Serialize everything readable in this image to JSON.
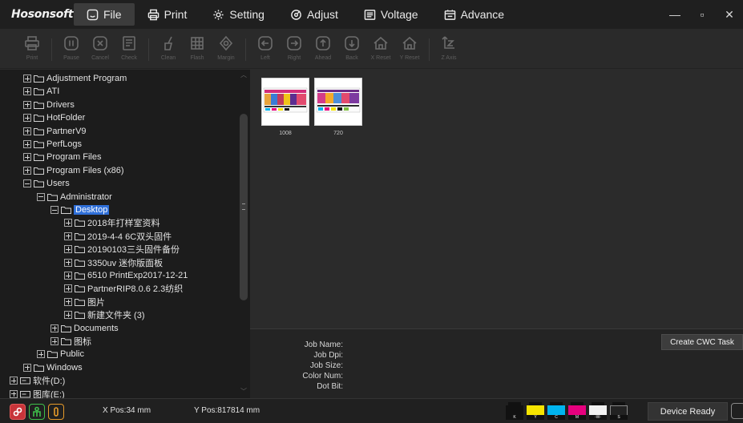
{
  "app": {
    "logo": "Hosonsoft"
  },
  "menu": [
    {
      "label": "File",
      "icon": "smile-icon"
    },
    {
      "label": "Print",
      "icon": "printer-icon"
    },
    {
      "label": "Setting",
      "icon": "gear-icon"
    },
    {
      "label": "Adjust",
      "icon": "adjust-icon"
    },
    {
      "label": "Voltage",
      "icon": "voltage-icon"
    },
    {
      "label": "Advance",
      "icon": "advance-icon"
    }
  ],
  "window": {
    "minimize": "—",
    "maximize": "▫",
    "close": "✕"
  },
  "toolbar": [
    {
      "label": "Print",
      "icon": "print-icon"
    },
    {
      "label": "Pause",
      "icon": "pause-icon"
    },
    {
      "label": "Cancel",
      "icon": "cancel-icon"
    },
    {
      "label": "Check",
      "icon": "check-icon"
    },
    {
      "label": "Clean",
      "icon": "clean-icon"
    },
    {
      "label": "Flash",
      "icon": "flash-icon"
    },
    {
      "label": "Margin",
      "icon": "margin-icon"
    },
    {
      "label": "Left",
      "icon": "left-icon"
    },
    {
      "label": "Right",
      "icon": "right-icon"
    },
    {
      "label": "Ahead",
      "icon": "ahead-icon"
    },
    {
      "label": "Back",
      "icon": "back-icon"
    },
    {
      "label": "X Reset",
      "icon": "x-reset-icon"
    },
    {
      "label": "Y Reset",
      "icon": "y-reset-icon"
    },
    {
      "label": "Z Axis",
      "icon": "z-axis-icon"
    }
  ],
  "tree": [
    {
      "label": "Adjustment Program",
      "level": 3,
      "expanded": false
    },
    {
      "label": "ATI",
      "level": 3,
      "expanded": false
    },
    {
      "label": "Drivers",
      "level": 3,
      "expanded": false
    },
    {
      "label": "HotFolder",
      "level": 3,
      "expanded": false
    },
    {
      "label": "PartnerV9",
      "level": 3,
      "expanded": false
    },
    {
      "label": "PerfLogs",
      "level": 3,
      "expanded": false
    },
    {
      "label": "Program Files",
      "level": 3,
      "expanded": false
    },
    {
      "label": "Program Files (x86)",
      "level": 3,
      "expanded": false
    },
    {
      "label": "Users",
      "level": 3,
      "expanded": true
    },
    {
      "label": "Administrator",
      "level": 4,
      "expanded": true
    },
    {
      "label": "Desktop",
      "level": 5,
      "expanded": true,
      "selected": true
    },
    {
      "label": "2018年打样室资料",
      "level": 6,
      "expanded": false
    },
    {
      "label": "2019-4-4 6C双头固件",
      "level": 6,
      "expanded": false
    },
    {
      "label": "20190103三头固件备份",
      "level": 6,
      "expanded": false
    },
    {
      "label": "3350uv 迷你版面板",
      "level": 6,
      "expanded": false
    },
    {
      "label": "6510 PrintExp2017-12-21",
      "level": 6,
      "expanded": false
    },
    {
      "label": "PartnerRIP8.0.6 2.3纺织",
      "level": 6,
      "expanded": false
    },
    {
      "label": "图片",
      "level": 6,
      "expanded": false
    },
    {
      "label": "新建文件夹 (3)",
      "level": 6,
      "expanded": false
    },
    {
      "label": "Documents",
      "level": 5,
      "expanded": false
    },
    {
      "label": "图标",
      "level": 5,
      "expanded": false
    },
    {
      "label": "Public",
      "level": 4,
      "expanded": false
    },
    {
      "label": "Windows",
      "level": 3,
      "expanded": false
    },
    {
      "label": "软件(D:)",
      "level": 2,
      "expanded": false,
      "drive": true
    },
    {
      "label": "图库(E:)",
      "level": 2,
      "expanded": false,
      "drive": true
    }
  ],
  "thumbnails": [
    {
      "label": "1008"
    },
    {
      "label": "720"
    }
  ],
  "job_info": {
    "name_label": "Job Name:",
    "dpi_label": "Job Dpi:",
    "size_label": "Job Size:",
    "color_label": "Color Num:",
    "dot_label": "Dot Bit:",
    "cwc_button": "Create CWC Task"
  },
  "status": {
    "x_pos": "X Pos:34 mm",
    "y_pos": "Y Pos:817814 mm",
    "device": "Device Ready",
    "inks": [
      {
        "tag": "K",
        "color": "#111111"
      },
      {
        "tag": "Y",
        "color": "#f5e400"
      },
      {
        "tag": "C",
        "color": "#00b4ef"
      },
      {
        "tag": "M",
        "color": "#e6007e"
      },
      {
        "tag": "-W-",
        "color": "#f2f2f2"
      },
      {
        "tag": "S",
        "color": "#222222"
      }
    ]
  },
  "colors": {
    "accent_selected": "#2f6fd8",
    "bg_dark": "#1c1c1c",
    "bg_panel": "#2b2b2b"
  }
}
